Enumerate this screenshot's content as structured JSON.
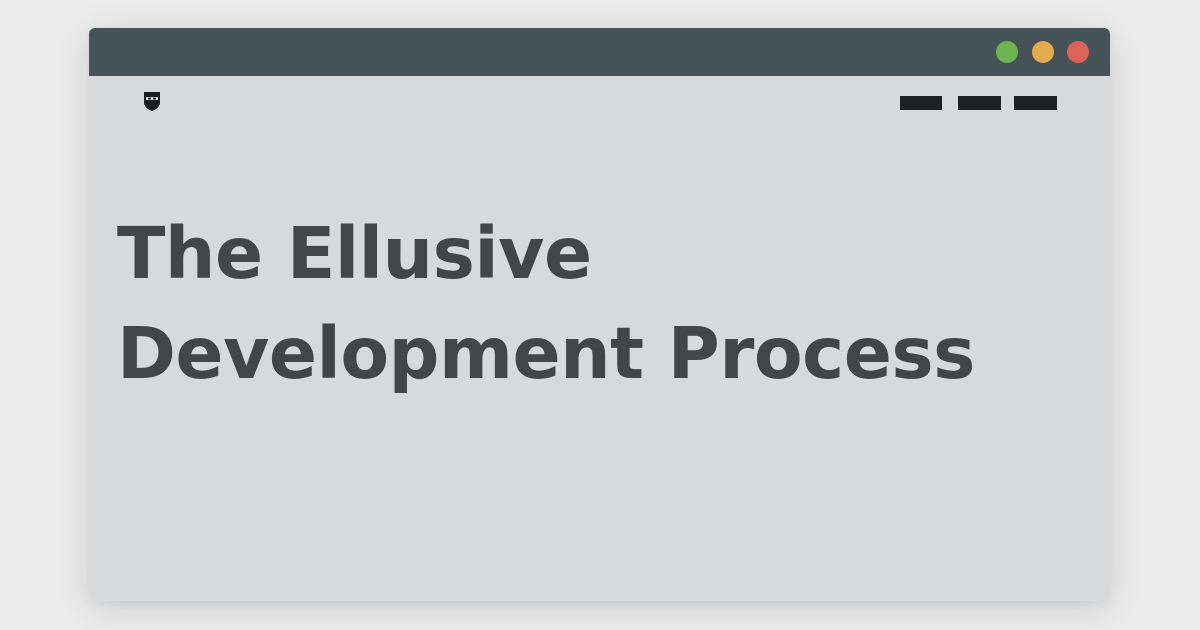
{
  "window": {
    "controls": [
      {
        "name": "maximize",
        "color": "#6ab54d"
      },
      {
        "name": "minimize",
        "color": "#e3ad4e"
      },
      {
        "name": "close",
        "color": "#dc6358"
      }
    ]
  },
  "header": {
    "logo_icon": "masked-face-shield-icon",
    "nav_items": [
      {
        "icon": "nav-placeholder-bar"
      },
      {
        "icon": "nav-placeholder-bar"
      },
      {
        "icon": "nav-placeholder-bar"
      }
    ]
  },
  "main": {
    "title_lines": [
      "The Ellusive",
      "Development Process"
    ]
  }
}
